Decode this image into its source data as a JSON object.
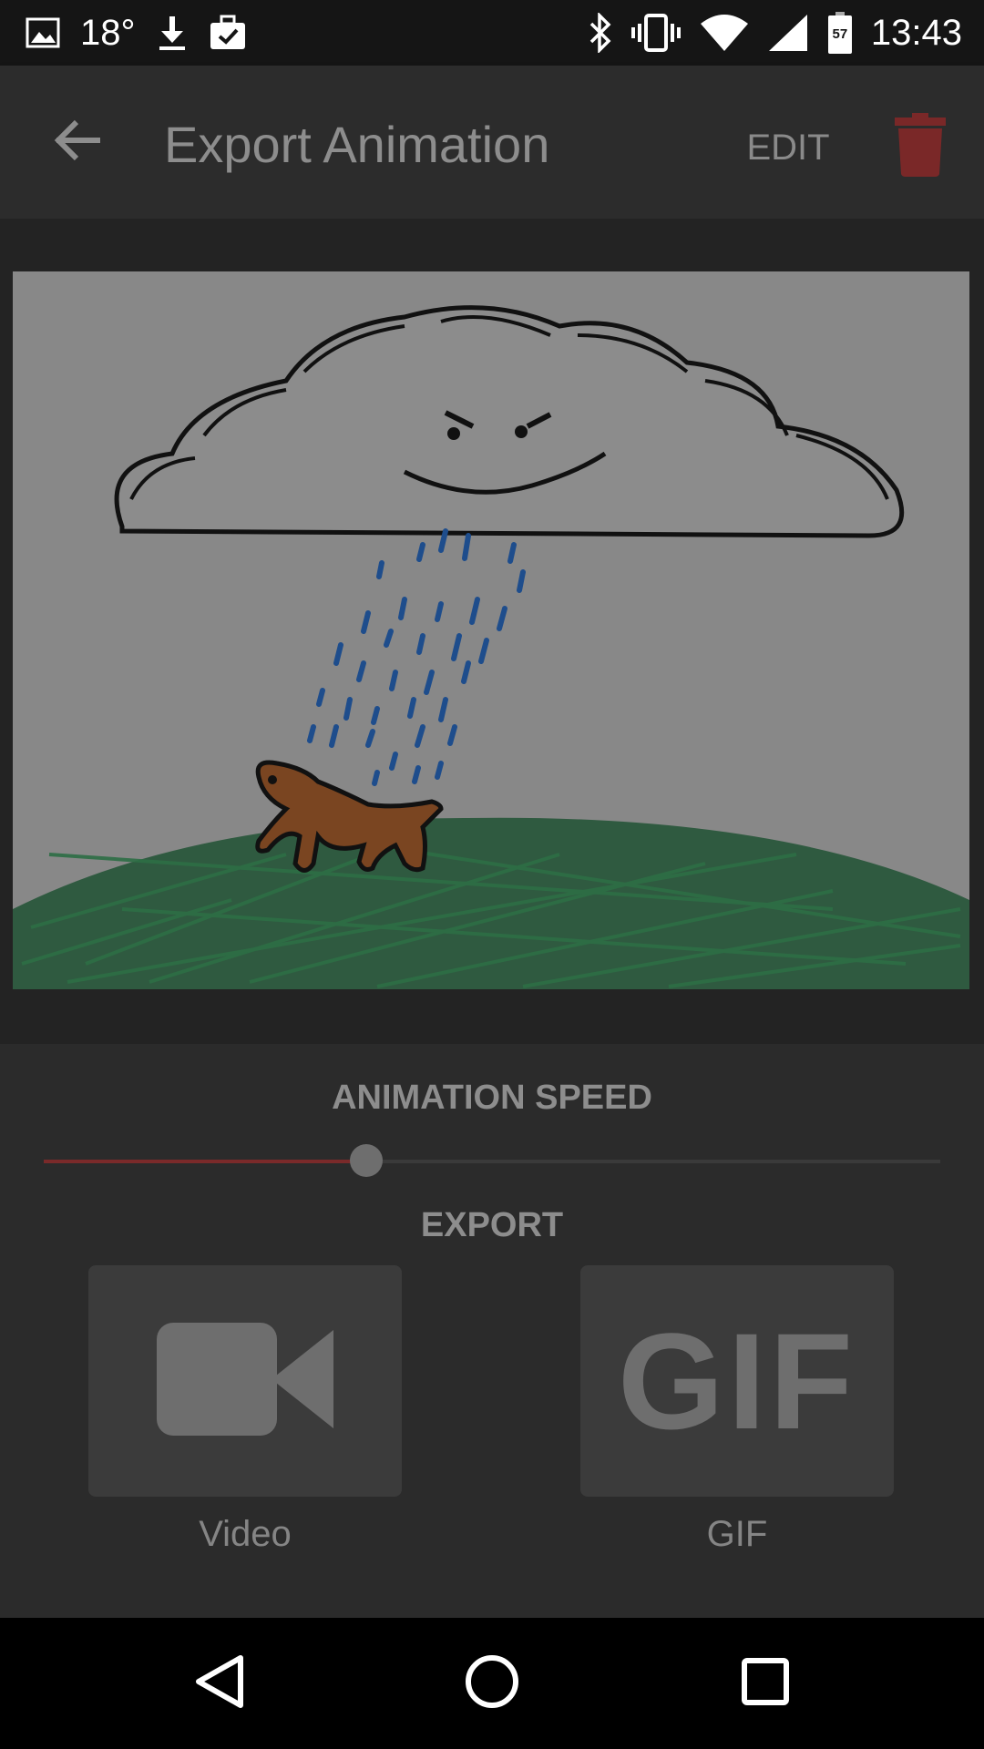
{
  "status_bar": {
    "temperature": "18°",
    "battery_level": "57",
    "time": "13:43",
    "icons": [
      "image-icon",
      "download-icon",
      "briefcase-check-icon",
      "bluetooth-icon",
      "vibrate-icon",
      "wifi-icon",
      "signal-icon",
      "battery-icon"
    ]
  },
  "app_bar": {
    "title": "Export Animation",
    "edit_label": "EDIT",
    "accent_color": "#7a2828"
  },
  "speed": {
    "label": "ANIMATION SPEED",
    "value_fraction": 0.36
  },
  "export": {
    "label": "EXPORT",
    "options": [
      {
        "label": "Video",
        "icon": "video-camera-icon"
      },
      {
        "label": "GIF",
        "glyph": "GIF",
        "icon": "gif-icon"
      }
    ]
  },
  "nav_bar": {
    "icons": [
      "back-triangle-icon",
      "home-circle-icon",
      "recents-square-icon"
    ]
  }
}
